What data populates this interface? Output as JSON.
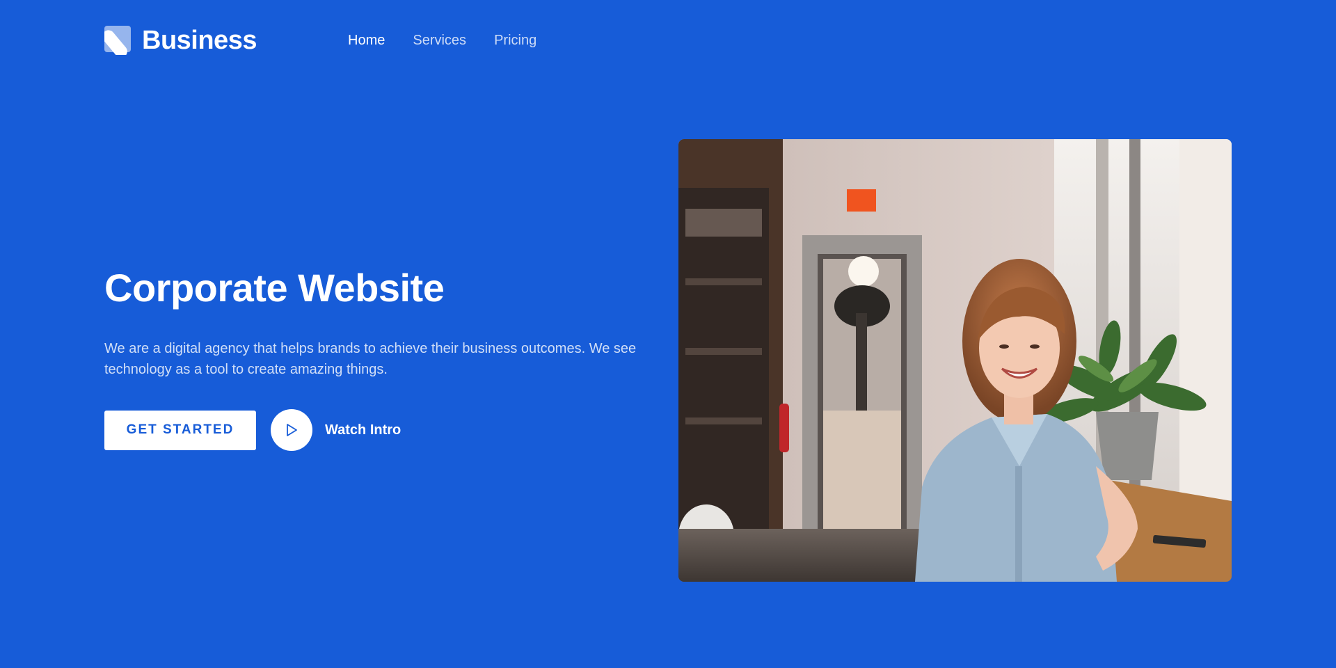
{
  "brand": {
    "name": "Business",
    "logo_icon": "brand-logo-icon"
  },
  "nav": {
    "items": [
      {
        "label": "Home",
        "active": true
      },
      {
        "label": "Services",
        "active": false
      },
      {
        "label": "Pricing",
        "active": false
      }
    ]
  },
  "hero": {
    "title": "Corporate Website",
    "description": "We are a digital agency that helps brands to achieve their business outcomes. We see technology as a tool to create amazing things.",
    "primary_button": "GET STARTED",
    "secondary_button": "Watch Intro",
    "secondary_icon": "play-icon"
  },
  "colors": {
    "background": "#175cd8",
    "text": "#ffffff",
    "button_text": "#175cd8"
  }
}
